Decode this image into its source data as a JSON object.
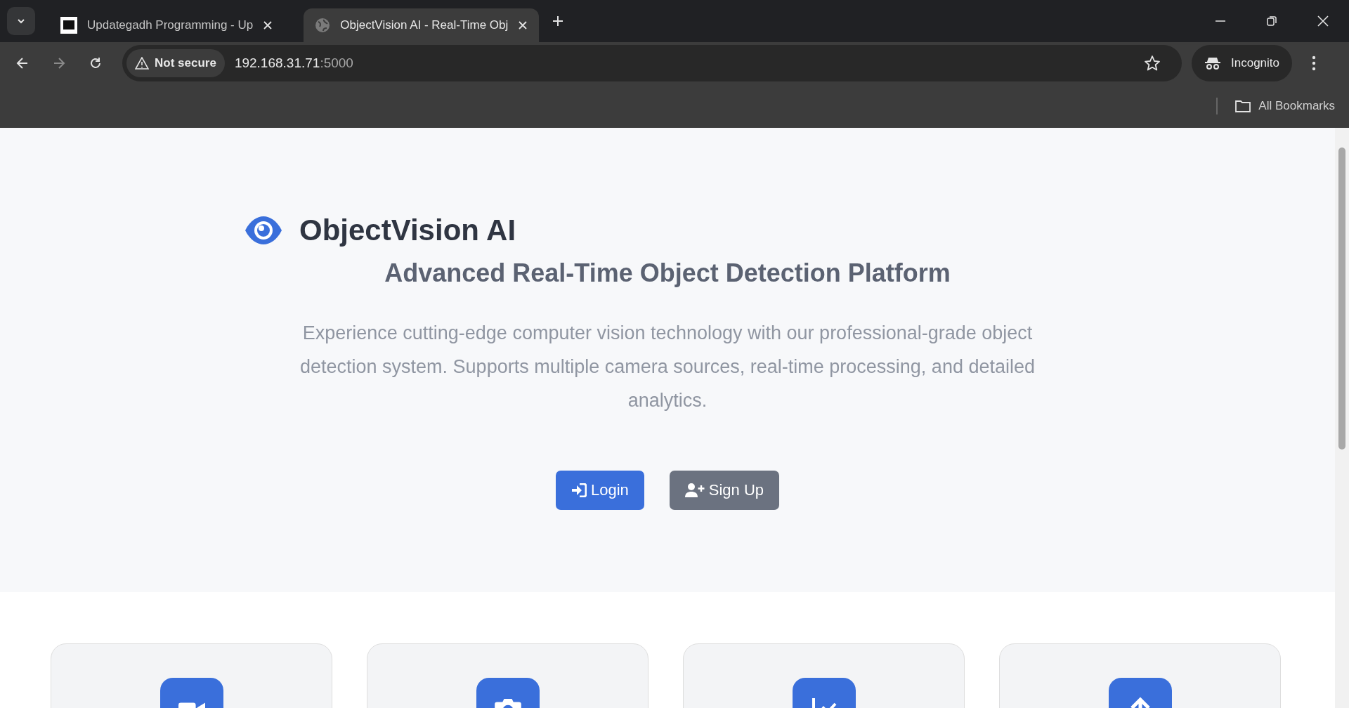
{
  "browser": {
    "tabs": [
      {
        "title": "Updategadh Programming - Up",
        "kind": "logo",
        "selected": false
      },
      {
        "title": "ObjectVision AI - Real-Time Obj",
        "kind": "globe",
        "selected": true
      }
    ],
    "security_label": "Not secure",
    "address": "192.168.31.71",
    "address_port": ":5000",
    "profile_label": "Incognito",
    "bookmarks_label": "All Bookmarks"
  },
  "hero": {
    "brand": "ObjectVision AI",
    "subtitle": "Advanced Real-Time Object Detection Platform",
    "description": "Experience cutting-edge computer vision technology with our professional-grade object detection system. Supports multiple camera sources, real-time processing, and detailed analytics.",
    "buttons": [
      {
        "label": "Login",
        "kind": "primary"
      },
      {
        "label": "Sign Up",
        "kind": "secondary"
      }
    ]
  },
  "features": [
    {
      "kind": "video"
    },
    {
      "kind": "camera"
    },
    {
      "kind": "chart"
    },
    {
      "kind": "upload"
    }
  ]
}
